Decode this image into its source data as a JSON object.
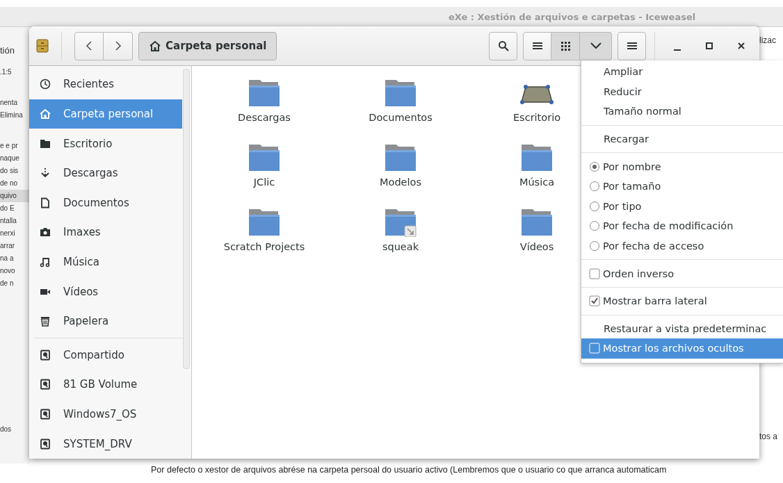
{
  "browser": {
    "title": "eXe : Xestión de arquivos e carpetas - Iceweasel",
    "left_fragments": [
      {
        "text": "tión",
        "highlighted": false
      },
      {
        "text": ".1:5",
        "highlighted": false
      },
      {
        "text": "nenta",
        "highlighted": false
      },
      {
        "text": "Elimina",
        "highlighted": false
      },
      {
        "text": "e e pr",
        "highlighted": false
      },
      {
        "text": "naque",
        "highlighted": false
      },
      {
        "text": "do sis",
        "highlighted": false
      },
      {
        "text": "de no",
        "highlighted": false
      },
      {
        "text": "quivo",
        "highlighted": true
      },
      {
        "text": "do E",
        "highlighted": false
      },
      {
        "text": "ntalla",
        "highlighted": false
      },
      {
        "text": "nerxi",
        "highlighted": false
      },
      {
        "text": "arrar",
        "highlighted": false
      },
      {
        "text": "na a",
        "highlighted": false
      },
      {
        "text": "novo",
        "highlighted": false
      },
      {
        "text": "de n",
        "highlighted": false
      },
      {
        "text": "dos",
        "highlighted": false
      }
    ],
    "right_fragments": [
      "lizac",
      "tos a"
    ],
    "body_text": "Por defecto o xestor de arquivos abrése na carpeta persoal do usuario activo (Lembremos que o usuario co que arranca automaticam"
  },
  "file_manager": {
    "path_button": {
      "label": "Carpeta personal"
    },
    "view_buttons": [
      {
        "kind": "list",
        "selected": false
      },
      {
        "kind": "grid",
        "selected": true
      },
      {
        "kind": "chevron",
        "selected": true
      }
    ],
    "sidebar": {
      "places": [
        {
          "label": "Recientes",
          "kind": "recent",
          "selected": false
        },
        {
          "label": "Carpeta personal",
          "kind": "home",
          "selected": true
        },
        {
          "label": "Escritorio",
          "kind": "desktop",
          "selected": false
        },
        {
          "label": "Descargas",
          "kind": "download",
          "selected": false
        },
        {
          "label": "Documentos",
          "kind": "document",
          "selected": false
        },
        {
          "label": "Imaxes",
          "kind": "camera",
          "selected": false
        },
        {
          "label": "Música",
          "kind": "music",
          "selected": false
        },
        {
          "label": "Vídeos",
          "kind": "video",
          "selected": false
        },
        {
          "label": "Papelera",
          "kind": "trash",
          "selected": false
        }
      ],
      "devices": [
        {
          "label": "Compartido",
          "kind": "drive",
          "selected": false
        },
        {
          "label": "81 GB Volume",
          "kind": "drive",
          "selected": false
        },
        {
          "label": "Windows7_OS",
          "kind": "drive",
          "selected": false
        },
        {
          "label": "SYSTEM_DRV",
          "kind": "drive",
          "selected": false
        }
      ]
    },
    "files": [
      {
        "name": "Descargas",
        "kind": "folder"
      },
      {
        "name": "Documentos",
        "kind": "folder"
      },
      {
        "name": "Escritorio",
        "kind": "desktop"
      },
      {
        "name": "JClic",
        "kind": "folder"
      },
      {
        "name": "Modelos",
        "kind": "folder"
      },
      {
        "name": "Música",
        "kind": "folder"
      },
      {
        "name": "Scratch Projects",
        "kind": "folder"
      },
      {
        "name": "squeak",
        "kind": "link"
      },
      {
        "name": "Vídeos",
        "kind": "folder"
      }
    ],
    "menu": {
      "sections": [
        [
          {
            "label": "Ampliar",
            "kind": "plain",
            "highlighted": false
          },
          {
            "label": "Reducir",
            "kind": "plain",
            "highlighted": false
          },
          {
            "label": "Tamaño normal",
            "kind": "plain",
            "highlighted": false
          }
        ],
        [
          {
            "label": "Recargar",
            "kind": "plain",
            "highlighted": false
          }
        ],
        [
          {
            "label": "Por nombre",
            "kind": "radio",
            "selected": true,
            "highlighted": false
          },
          {
            "label": "Por tamaño",
            "kind": "radio",
            "selected": false,
            "highlighted": false
          },
          {
            "label": "Por tipo",
            "kind": "radio",
            "selected": false,
            "highlighted": false
          },
          {
            "label": "Por fecha de modificación",
            "kind": "radio",
            "selected": false,
            "highlighted": false
          },
          {
            "label": "Por fecha de acceso",
            "kind": "radio",
            "selected": false,
            "highlighted": false
          }
        ],
        [
          {
            "label": "Orden inverso",
            "kind": "check",
            "checked": false,
            "highlighted": false
          }
        ],
        [
          {
            "label": "Mostrar barra lateral",
            "kind": "check",
            "checked": true,
            "highlighted": false
          }
        ],
        [
          {
            "label": "Restaurar a vista predeterminac",
            "kind": "plain",
            "highlighted": false
          },
          {
            "label": "Mostrar los archivos ocultos",
            "kind": "check",
            "checked": false,
            "highlighted": true
          }
        ]
      ]
    }
  }
}
